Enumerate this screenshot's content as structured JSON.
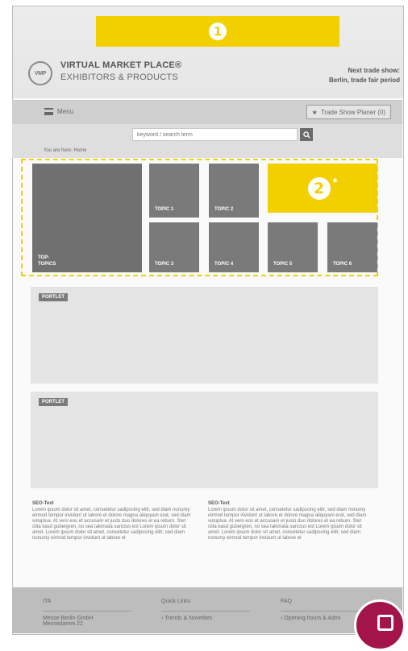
{
  "banner": {
    "badge": "1"
  },
  "logo": {
    "icon_text": "VMP",
    "title": "VIRTUAL MARKET PLACE®",
    "subtitle": "EXHIBITORS & PRODUCTS"
  },
  "trade_show": {
    "line1": "Next trade show:",
    "line2": "Berlin, trade fair period"
  },
  "nav": {
    "menu_label": "Menu",
    "planner_label": "Trade Show Planer (0)"
  },
  "search": {
    "placeholder": "keyword / search term"
  },
  "breadcrumb": {
    "text": "You are here:  Home"
  },
  "topics": {
    "top": "TOP-\nTOPICS",
    "t1": "TOPIC 1",
    "t2": "TOPIC 2",
    "t3": "TOPIC 3",
    "t4": "TOPIC 4",
    "t5": "TOPIC 5",
    "t6": "TOPIC 6",
    "badge": "2",
    "star": "*"
  },
  "portlets": [
    {
      "label": "PORTLET"
    },
    {
      "label": "PORTLET"
    }
  ],
  "seo": [
    {
      "title": "SEO-Text",
      "body": "Lorem ipsum dolor sit amet, consetetur sadipscing elitr, sed diam nonumy eirmod tempor invidunt ut labore et dolore magna aliquyam erat, sed diam voluptua. At vero eos et accusam et justo duo dolores et ea rebum. Stet clita kasd gubergren, no sea takimata sanctus est Lorem ipsum dolor sit amet. Lorem ipsum dolor sit amet, consetetur sadipscing elitr, sed diam nonumy eirmod tempor invidunt ut labore et"
    },
    {
      "title": "SEO-Text",
      "body": "Lorem ipsum dolor sit amet, consetetur sadipscing elitr, sed diam nonumy eirmod tempor invidunt ut labore et dolore magna aliquyam erat, sed diam voluptua. At vero eos et accusam et justo duo dolores et ea rebum. Stet clita kasd gubergren, no sea takimata sanctus est Lorem ipsum dolor sit amet. Lorem ipsum dolor sit amet, consetetur sadipscing elitr, sed diam nonumy eirmod tempor invidunt ut labore et"
    }
  ],
  "footer": {
    "col1": {
      "heading": "ITA",
      "line1": "Messe Berlin GmbH",
      "line2": "Messedamm 22"
    },
    "col2": {
      "heading": "Quick Links",
      "link1": "› Trends & Novelties"
    },
    "col3": {
      "heading": "FAQ",
      "link1": "› Opening hours & Admi"
    }
  },
  "colors": {
    "accent": "#f2d000",
    "fab": "#a3144a",
    "tile": "#7a7a7a"
  }
}
